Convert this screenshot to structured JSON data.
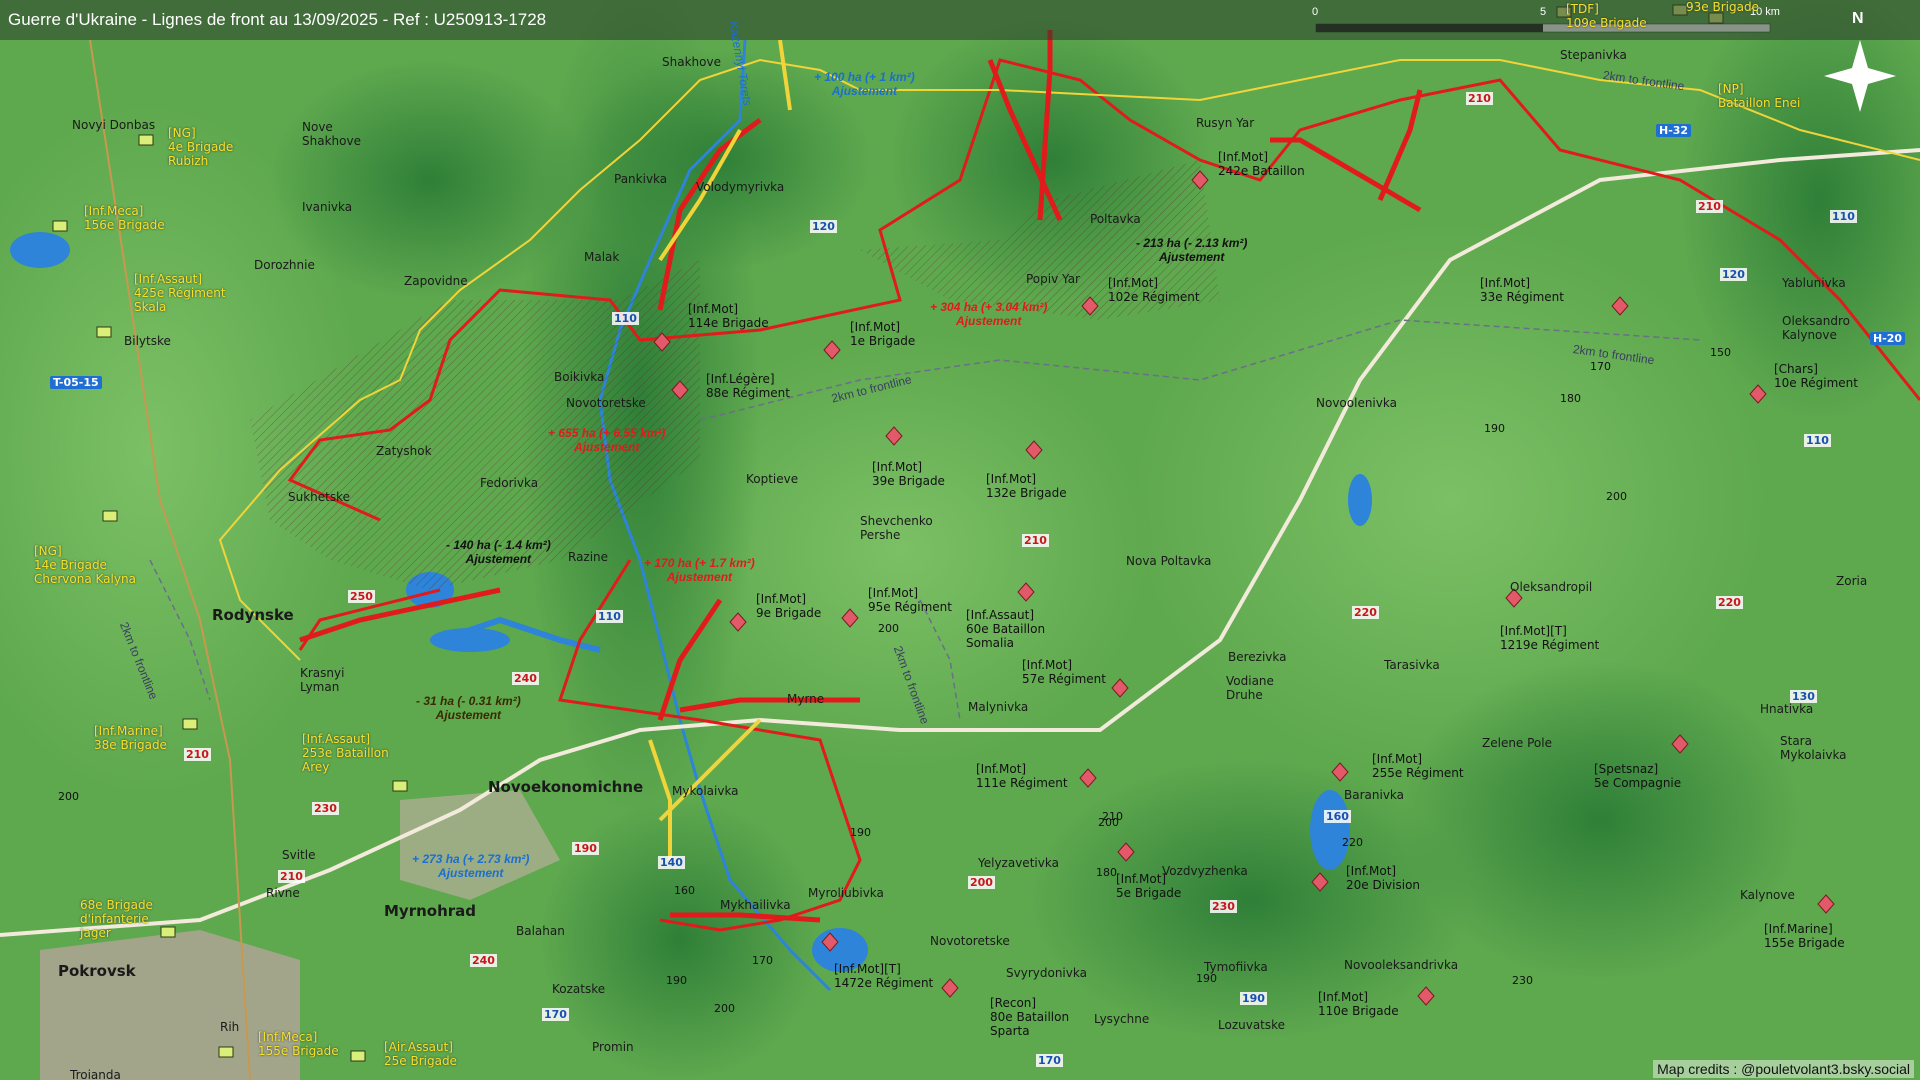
{
  "title": "Guerre d'Ukraine - Lignes de front au 13/09/2025 - Ref : U250913-1728",
  "credits": "Map credits : @pouletvolant3.bsky.social",
  "scale": {
    "zero": "0",
    "mid": "5",
    "end": "10 km"
  },
  "north": "N",
  "colors": {
    "front": "#e11b1b",
    "ua": "#f0d43a",
    "terrain": "#5ea84e"
  },
  "places": [
    {
      "name": "Shakhove"
    },
    {
      "name": "Novyi Donbas"
    },
    {
      "name": "Nove\nShakhove"
    },
    {
      "name": "Ivanivka"
    },
    {
      "name": "Pankivka"
    },
    {
      "name": "Volodymyrivka"
    },
    {
      "name": "Dorozhnie"
    },
    {
      "name": "Malak"
    },
    {
      "name": "Zapovidne"
    },
    {
      "name": "Bilytske"
    },
    {
      "name": "Boikivka"
    },
    {
      "name": "Novotoretske"
    },
    {
      "name": "Zatyshok"
    },
    {
      "name": "Sukhetske"
    },
    {
      "name": "Fedorivka"
    },
    {
      "name": "Koptieve"
    },
    {
      "name": "Razine"
    },
    {
      "name": "Shevchenko\nPershe"
    },
    {
      "name": "Rodynske",
      "big": true
    },
    {
      "name": "Krasnyi\nLyman"
    },
    {
      "name": "Novoekonomichne",
      "big": true
    },
    {
      "name": "Mykolaivka"
    },
    {
      "name": "Myrne"
    },
    {
      "name": "Malynivka"
    },
    {
      "name": "Svitle"
    },
    {
      "name": "Rivne"
    },
    {
      "name": "Myrnohrad",
      "big": true
    },
    {
      "name": "Balahan"
    },
    {
      "name": "Mykhailivka"
    },
    {
      "name": "Myroliubivka"
    },
    {
      "name": "Pokrovsk",
      "big": true
    },
    {
      "name": "Kozatske"
    },
    {
      "name": "Promin"
    },
    {
      "name": "Rih"
    },
    {
      "name": "Troianda"
    },
    {
      "name": "Novotoretske"
    },
    {
      "name": "Svyrydonivka"
    },
    {
      "name": "Lysychne"
    },
    {
      "name": "Yelyzavetivka"
    },
    {
      "name": "Vozdvyzhenka"
    },
    {
      "name": "Tymofiivka"
    },
    {
      "name": "Lozuvatske"
    },
    {
      "name": "Novooleksandrivka"
    },
    {
      "name": "Baranivka"
    },
    {
      "name": "Zelene Pole"
    },
    {
      "name": "Berezivka"
    },
    {
      "name": "Vodiane\nDruhe"
    },
    {
      "name": "Tarasivka"
    },
    {
      "name": "Nova Poltavka"
    },
    {
      "name": "Oleksandropil"
    },
    {
      "name": "Zoria"
    },
    {
      "name": "Hnativka"
    },
    {
      "name": "Stara\nMykolaivka"
    },
    {
      "name": "Kalynove"
    },
    {
      "name": "Novoolenivka"
    },
    {
      "name": "Popiv Yar"
    },
    {
      "name": "Poltavka"
    },
    {
      "name": "Rusyn Yar"
    },
    {
      "name": "Stepanivka"
    },
    {
      "name": "Yablunivka"
    },
    {
      "name": "Oleksandro\nKalynove"
    }
  ],
  "units_red": [
    {
      "label": "[Inf.Mot]\n114e Brigade"
    },
    {
      "label": "[Inf.Mot]\n1e Brigade"
    },
    {
      "label": "[Inf.Légère]\n88e Régiment"
    },
    {
      "label": "[Inf.Mot]\n39e Brigade"
    },
    {
      "label": "[Inf.Mot]\n132e Brigade"
    },
    {
      "label": "[Inf.Mot]\n102e Régiment"
    },
    {
      "label": "[Inf.Mot]\n242e Bataillon"
    },
    {
      "label": "[Inf.Mot]\n33e Régiment"
    },
    {
      "label": "[Chars]\n10e Régiment"
    },
    {
      "label": "[Inf.Mot]\n9e Brigade"
    },
    {
      "label": "[Inf.Mot]\n95e Régiment"
    },
    {
      "label": "[Inf.Assaut]\n60e Bataillon\nSomalia"
    },
    {
      "label": "[Inf.Mot]\n57e Régiment"
    },
    {
      "label": "[Inf.Mot]\n111e Régiment"
    },
    {
      "label": "[Inf.Mot]\n5e Brigade"
    },
    {
      "label": "[Inf.Mot][T]\n1472e Régiment"
    },
    {
      "label": "[Recon]\n80e Bataillon\nSparta"
    },
    {
      "label": "[Inf.Mot]\n255e Régiment"
    },
    {
      "label": "[Inf.Mot]\n20e Division"
    },
    {
      "label": "[Inf.Mot]\n110e Brigade"
    },
    {
      "label": "[Inf.Mot][T]\n1219e Régiment"
    },
    {
      "label": "[Spetsnaz]\n5e Compagnie"
    },
    {
      "label": "[Inf.Marine]\n155e Brigade"
    }
  ],
  "units_ua": [
    {
      "label": "[NG]\n4e Brigade\nRubizh"
    },
    {
      "label": "[Inf.Meca]\n156e Brigade"
    },
    {
      "label": "[Inf.Assaut]\n425e Régiment\nSkala"
    },
    {
      "label": "[NG]\n14e Brigade\nChervona Kalyna"
    },
    {
      "label": "[Inf.Marine]\n38e Brigade"
    },
    {
      "label": "[Inf.Assaut]\n253e Bataillon\nArey"
    },
    {
      "label": "68e Brigade\nd'infanterie\nJager"
    },
    {
      "label": "[Inf.Meca]\n155e Brigade"
    },
    {
      "label": "[Air.Assaut]\n25e Brigade"
    },
    {
      "label": "[NP]\nBataillon Enei"
    },
    {
      "label": "[TDF]\n109e Brigade"
    },
    {
      "label": "93e Brigade"
    }
  ],
  "annotations": [
    {
      "text": "+ 100 ha (+ 1 km²)\nAjustement",
      "color": "blue"
    },
    {
      "text": "+ 304 ha (+ 3.04 km²)\nAjustement",
      "color": "red"
    },
    {
      "text": "- 213 ha (- 2.13 km²)\nAjustement",
      "color": "black"
    },
    {
      "text": "+ 655 ha (+ 6.55 km²)\nAjustement",
      "color": "red"
    },
    {
      "text": "- 140 ha (- 1.4 km²)\nAjustement",
      "color": "black"
    },
    {
      "text": "+ 170 ha (+ 1.7 km²)\nAjustement",
      "color": "red"
    },
    {
      "text": "- 31 ha (- 0.31 km²)\nAjustement",
      "color": "yel"
    },
    {
      "text": "+ 273 ha (+ 2.73 km²)\nAjustement",
      "color": "blue"
    }
  ],
  "frontline_labels": [
    "2km to frontline",
    "2km to frontline",
    "2km to frontline",
    "2km to frontline",
    "2km to frontline"
  ],
  "river_label": "Kazennyi Torets",
  "roads_blue": [
    "T-05-15",
    "H-32",
    "H-20"
  ],
  "road_numbers": [
    "120",
    "110",
    "110",
    "120",
    "110",
    "110",
    "130",
    "140",
    "160",
    "170",
    "170",
    "190",
    "210",
    "210",
    "210",
    "210",
    "210",
    "220",
    "220",
    "230",
    "230",
    "240",
    "240",
    "250",
    "200",
    "190"
  ],
  "elevations": [
    "170",
    "180",
    "190",
    "150",
    "200",
    "200",
    "190",
    "200",
    "180",
    "160",
    "170",
    "190",
    "200",
    "190",
    "210",
    "220",
    "230",
    "200"
  ]
}
